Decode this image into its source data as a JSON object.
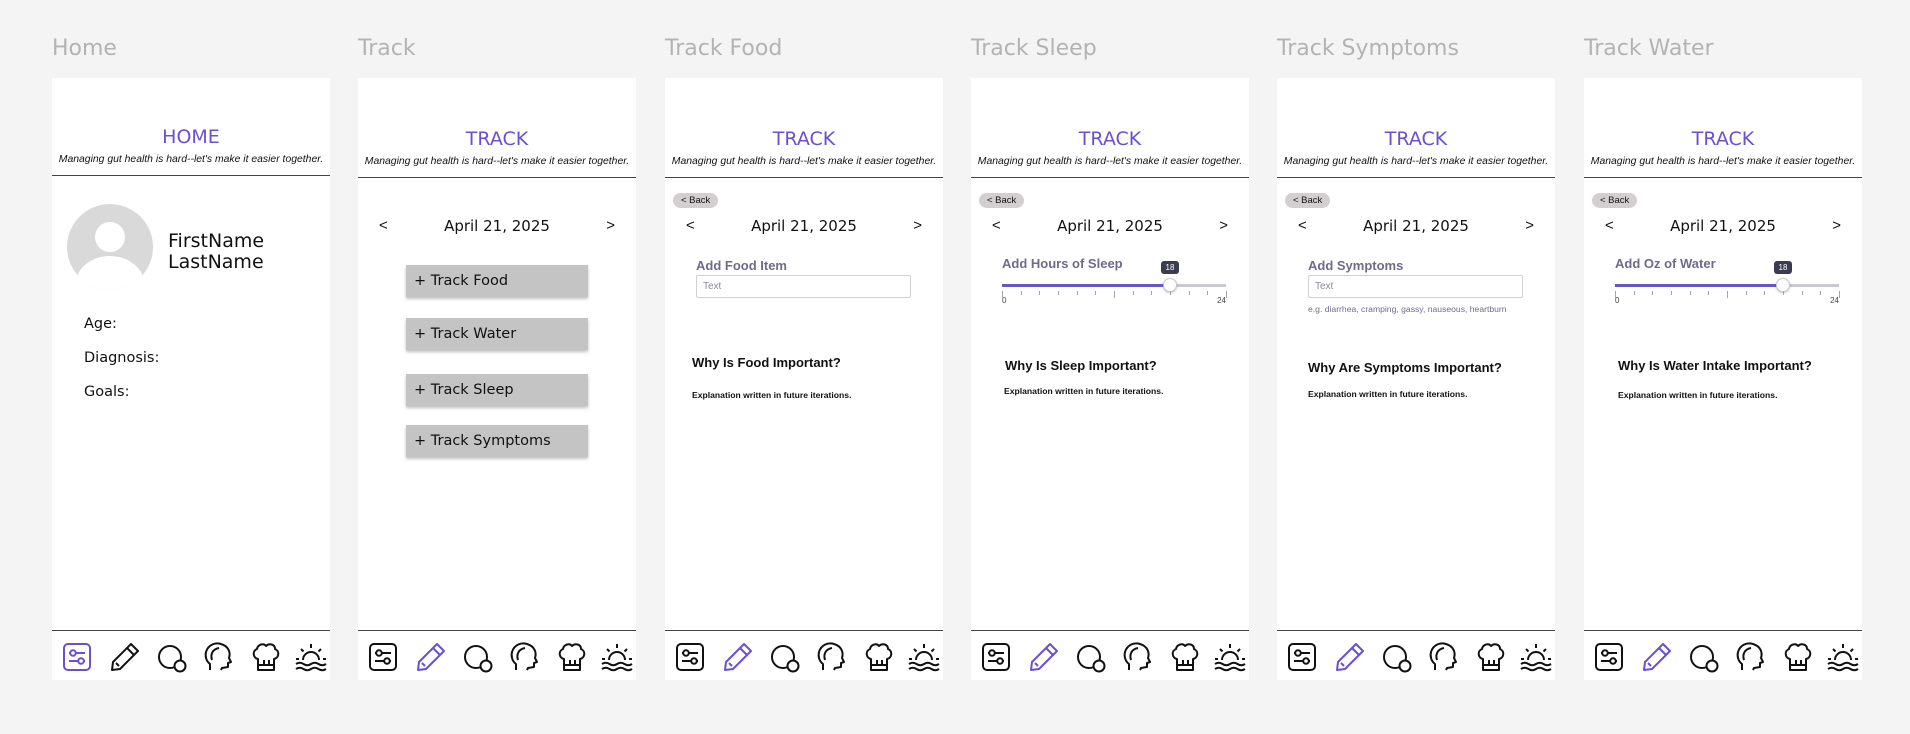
{
  "frames": [
    {
      "label": "Home",
      "title": "HOME",
      "subtitle": "Managing gut health is hard--let's make it easier together."
    },
    {
      "label": "Track",
      "title": "TRACK",
      "subtitle": "Managing gut health is hard--let's make it easier together."
    },
    {
      "label": "Track Food",
      "title": "TRACK",
      "subtitle": "Managing gut health is hard--let's make it easier together."
    },
    {
      "label": "Track Sleep",
      "title": "TRACK",
      "subtitle": "Managing gut health is hard--let's make it easier together."
    },
    {
      "label": "Track Symptoms",
      "title": "TRACK",
      "subtitle": "Managing gut health is hard--let's make it easier together."
    },
    {
      "label": "Track Water",
      "title": "TRACK",
      "subtitle": "Managing gut health is hard--let's make it easier together."
    }
  ],
  "home": {
    "first_name": "FirstName",
    "last_name": "LastName",
    "age_label": "Age:",
    "diagnosis_label": "Diagnosis:",
    "goals_label": "Goals:"
  },
  "date_nav": {
    "prev": "<",
    "date": "April 21, 2025",
    "next": ">"
  },
  "back_label": "< Back",
  "track_buttons": [
    "+ Track Food",
    "+ Track Water",
    "+ Track Sleep",
    "+ Track Symptoms"
  ],
  "food": {
    "field_label": "Add Food Item",
    "placeholder": "Text",
    "why_title": "Why Is Food Important?",
    "why_text": "Explanation written in future iterations."
  },
  "sleep": {
    "field_label": "Add Hours of Sleep",
    "slider": {
      "value": 18,
      "min": 0,
      "max": 24,
      "value_label": "18",
      "min_label": "0",
      "max_label": "24"
    },
    "why_title": "Why Is Sleep Important?",
    "why_text": "Explanation written in future iterations."
  },
  "symptoms": {
    "field_label": "Add Symptoms",
    "placeholder": "Text",
    "hint": "e.g. diarrhea, cramping, gassy, nauseous, heartburn",
    "why_title": "Why Are Symptoms Important?",
    "why_text": "Explanation written in future iterations."
  },
  "water": {
    "field_label": "Add Oz of Water",
    "slider": {
      "value": 18,
      "min": 0,
      "max": 24,
      "value_label": "18",
      "min_label": "0",
      "max_label": "24"
    },
    "why_title": "Why Is Water Intake Important?",
    "why_text": "Explanation written in future iterations."
  },
  "nav_items": [
    "sliders-icon",
    "pencil-icon",
    "chat-bubble-icon",
    "head-profile-icon",
    "chef-hat-icon",
    "sunrise-icon"
  ],
  "colors": {
    "accent": "#6b4fd0",
    "background": "#f4f4f4",
    "nav_default": "#111111",
    "button_gray": "#c4c4c4"
  }
}
